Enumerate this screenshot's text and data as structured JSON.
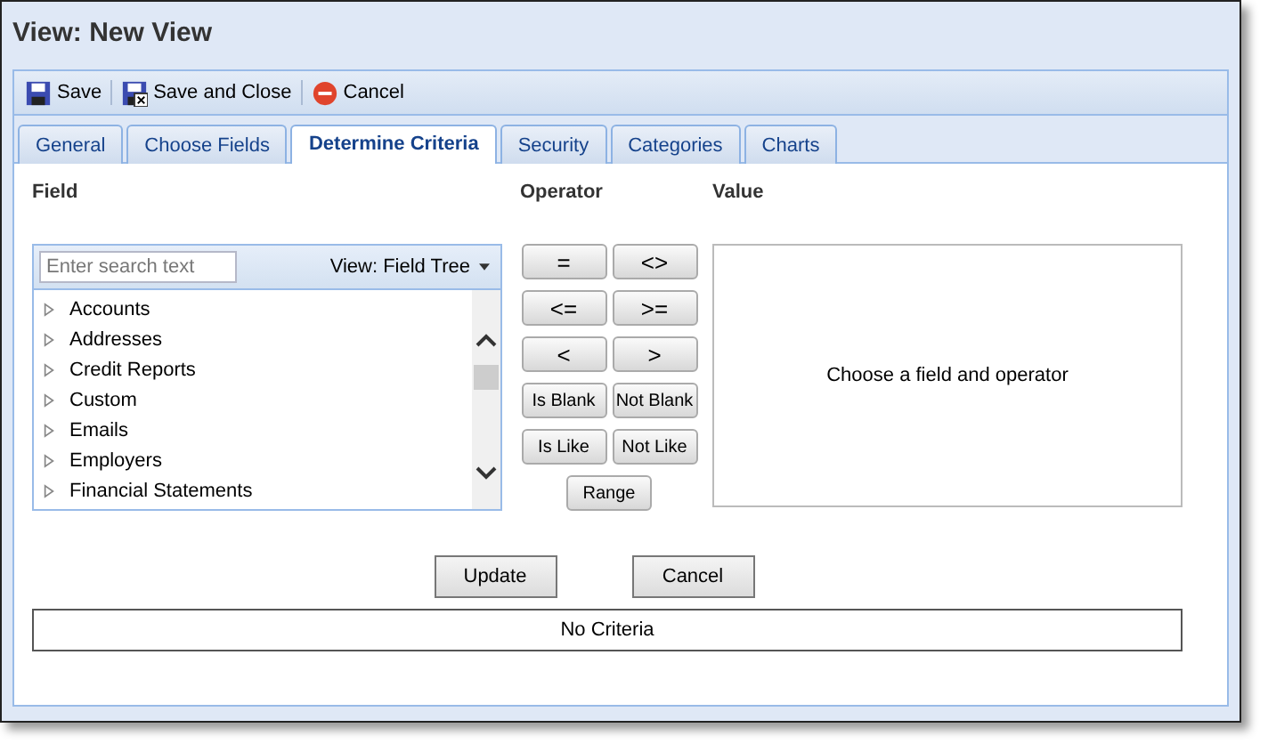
{
  "window": {
    "title": "View: New View"
  },
  "toolbar": [
    {
      "kind": "save",
      "label": "Save"
    },
    {
      "kind": "save-close",
      "label": "Save and Close"
    },
    {
      "kind": "cancel",
      "label": "Cancel"
    }
  ],
  "tabs": [
    {
      "label": "General",
      "selected": false
    },
    {
      "label": "Choose Fields",
      "selected": false
    },
    {
      "label": "Determine Criteria",
      "selected": true
    },
    {
      "label": "Security",
      "selected": false
    },
    {
      "label": "Categories",
      "selected": false
    },
    {
      "label": "Charts",
      "selected": false
    }
  ],
  "headings": {
    "field": "Field",
    "operator": "Operator",
    "value": "Value"
  },
  "field_tree": {
    "search_placeholder": "Enter search text",
    "view_label": "View: Field Tree",
    "items": [
      {
        "label": "Accounts",
        "expanded": false
      },
      {
        "label": "Addresses",
        "expanded": false
      },
      {
        "label": "Credit Reports",
        "expanded": false
      },
      {
        "label": "Custom",
        "expanded": false
      },
      {
        "label": "Emails",
        "expanded": false
      },
      {
        "label": "Employers",
        "expanded": false
      },
      {
        "label": "Financial Statements",
        "expanded": false
      }
    ]
  },
  "operators": [
    {
      "label": "=",
      "kind": "symbol"
    },
    {
      "label": "<>",
      "kind": "symbol"
    },
    {
      "label": "<=",
      "kind": "symbol"
    },
    {
      "label": ">=",
      "kind": "symbol"
    },
    {
      "label": "<",
      "kind": "symbol"
    },
    {
      "label": ">",
      "kind": "symbol"
    },
    {
      "label": "Is Blank",
      "kind": "word"
    },
    {
      "label": "Not Blank",
      "kind": "word"
    },
    {
      "label": "Is Like",
      "kind": "word"
    },
    {
      "label": "Not Like",
      "kind": "word"
    },
    {
      "label": "Range",
      "kind": "word"
    }
  ],
  "value_hint": "Choose a field and operator",
  "buttons": [
    "Update",
    "Cancel"
  ],
  "criteria": "No Criteria"
}
